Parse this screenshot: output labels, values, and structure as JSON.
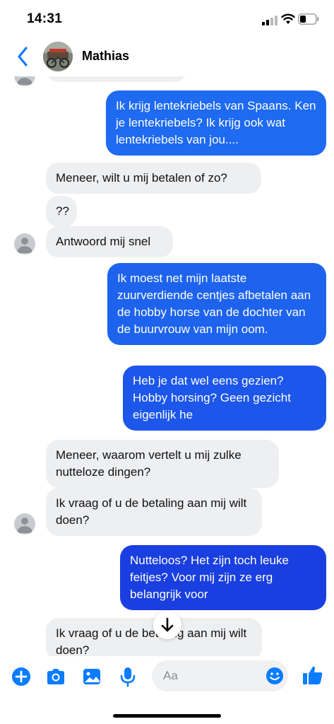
{
  "status_bar": {
    "time": "14:31"
  },
  "header": {
    "contact_name": "Mathias"
  },
  "messages": [
    {
      "dir": "out",
      "text": "Ik krijg lentekriebels van Spaans. Ken je lentekriebels? Ik krijg ook wat lentekriebels van jou...."
    },
    {
      "dir": "in",
      "text": "Meneer, wilt u mij betalen of zo?"
    },
    {
      "dir": "in",
      "text": "??"
    },
    {
      "dir": "in",
      "text": "Antwoord mij snel"
    },
    {
      "dir": "out",
      "text": "Ik moest net mijn laatste zuurverdiende centjes afbetalen aan de hobby horse van de dochter van de buurvrouw van mijn oom."
    },
    {
      "dir": "out",
      "text": "Heb je dat wel eens gezien? Hobby horsing? Geen gezicht eigenlijk he"
    },
    {
      "dir": "in",
      "text": "Meneer, waarom vertelt u mij zulke nutteloze dingen?"
    },
    {
      "dir": "in",
      "text": "Ik vraag of u de betaling aan mij wilt doen?"
    },
    {
      "dir": "out",
      "text": "Nutteloos? Het zijn toch leuke feitjes? Voor mij zijn ze erg belangrijk voor"
    },
    {
      "dir": "in",
      "text": "Ik vraag of u de betaling aan mij wilt doen?"
    }
  ],
  "composer": {
    "placeholder": "Aa"
  },
  "icons": [
    "back-chevron-icon",
    "plus-icon",
    "camera-icon",
    "image-icon",
    "microphone-icon",
    "emoji-icon",
    "thumbs-up-icon",
    "arrow-down-icon"
  ],
  "colors": {
    "accent": "#0a7cff",
    "outgoing_top": "#1e6af0",
    "outgoing_bottom": "#1a3fe0",
    "incoming": "#eeeff1"
  }
}
